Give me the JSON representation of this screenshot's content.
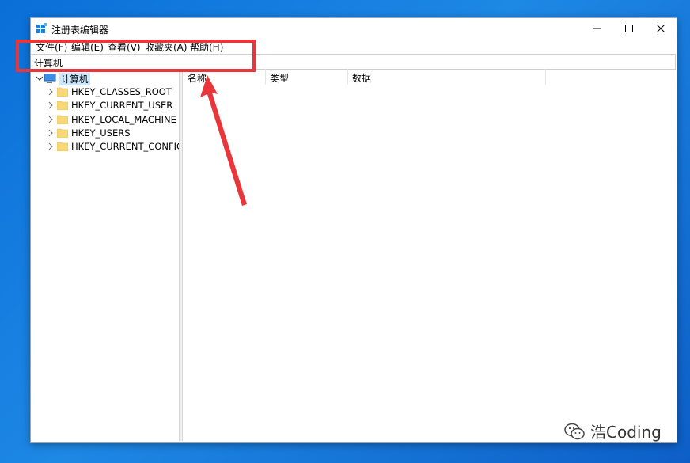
{
  "window": {
    "title": "注册表编辑器"
  },
  "menu": [
    {
      "label": "文件(F)"
    },
    {
      "label": "编辑(E)"
    },
    {
      "label": "查看(V)"
    },
    {
      "label": "收藏夹(A)"
    },
    {
      "label": "帮助(H)"
    }
  ],
  "address": {
    "value": "计算机"
  },
  "tree": {
    "root": {
      "label": "计算机",
      "icon": "computer-icon"
    },
    "children": [
      {
        "label": "HKEY_CLASSES_ROOT",
        "icon": "folder-icon"
      },
      {
        "label": "HKEY_CURRENT_USER",
        "icon": "folder-icon"
      },
      {
        "label": "HKEY_LOCAL_MACHINE",
        "icon": "folder-icon"
      },
      {
        "label": "HKEY_USERS",
        "icon": "folder-icon"
      },
      {
        "label": "HKEY_CURRENT_CONFIG",
        "icon": "folder-icon"
      }
    ]
  },
  "list": {
    "columns": [
      {
        "label": "名称"
      },
      {
        "label": "类型"
      },
      {
        "label": "数据"
      }
    ]
  },
  "annotation": {
    "color": "#e8363b"
  },
  "watermark": {
    "text": "浩Coding",
    "icon": "wechat-icon"
  },
  "colors": {
    "desktop": "#1e88e5",
    "selection": "#cce8ff",
    "accent_red": "#e8363b"
  }
}
